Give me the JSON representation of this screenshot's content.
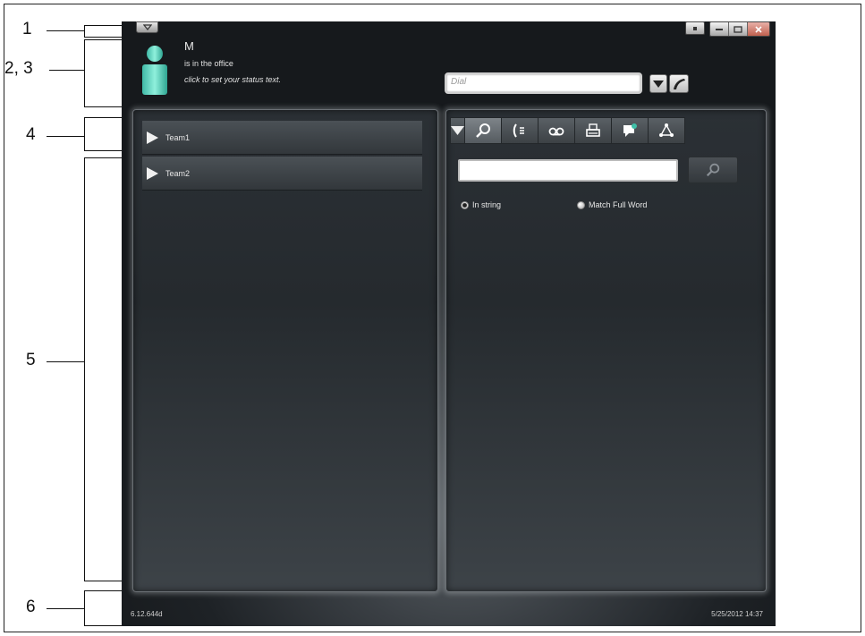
{
  "callouts": [
    "1",
    "2, 3",
    "4",
    "5",
    "6"
  ],
  "window": {
    "menu_icon": "chevron-down-icon",
    "controls": [
      "restore-small-icon",
      "minimize-icon",
      "maximize-icon",
      "close-icon"
    ]
  },
  "user": {
    "name": "M",
    "presence": "is in the office",
    "status_prompt": "click to set your status text."
  },
  "dial": {
    "placeholder": "Dial",
    "dropdown_icon": "triangle-down-icon",
    "call_icon": "phone-handset-icon"
  },
  "teams": [
    {
      "label": "Team1",
      "icon": "triangle-right-icon"
    },
    {
      "label": "Team2",
      "icon": "triangle-right-icon"
    }
  ],
  "toolbar": {
    "tabs": [
      "search-icon",
      "call-journal-icon",
      "voicemail-icon",
      "fax-icon",
      "chat-icon",
      "network-icon"
    ],
    "active_tab": "search-icon"
  },
  "search": {
    "input_value": "",
    "button_icon": "search-icon",
    "options": [
      {
        "label": "In string",
        "selected": true
      },
      {
        "label": "Match Full Word",
        "selected": false
      }
    ]
  },
  "footer": {
    "version": "6.12.644d",
    "datetime": "5/25/2012 14:37"
  },
  "colors": {
    "app_background": "#1e2226",
    "panel": "#2b3035",
    "text": "#e6e6e6"
  }
}
